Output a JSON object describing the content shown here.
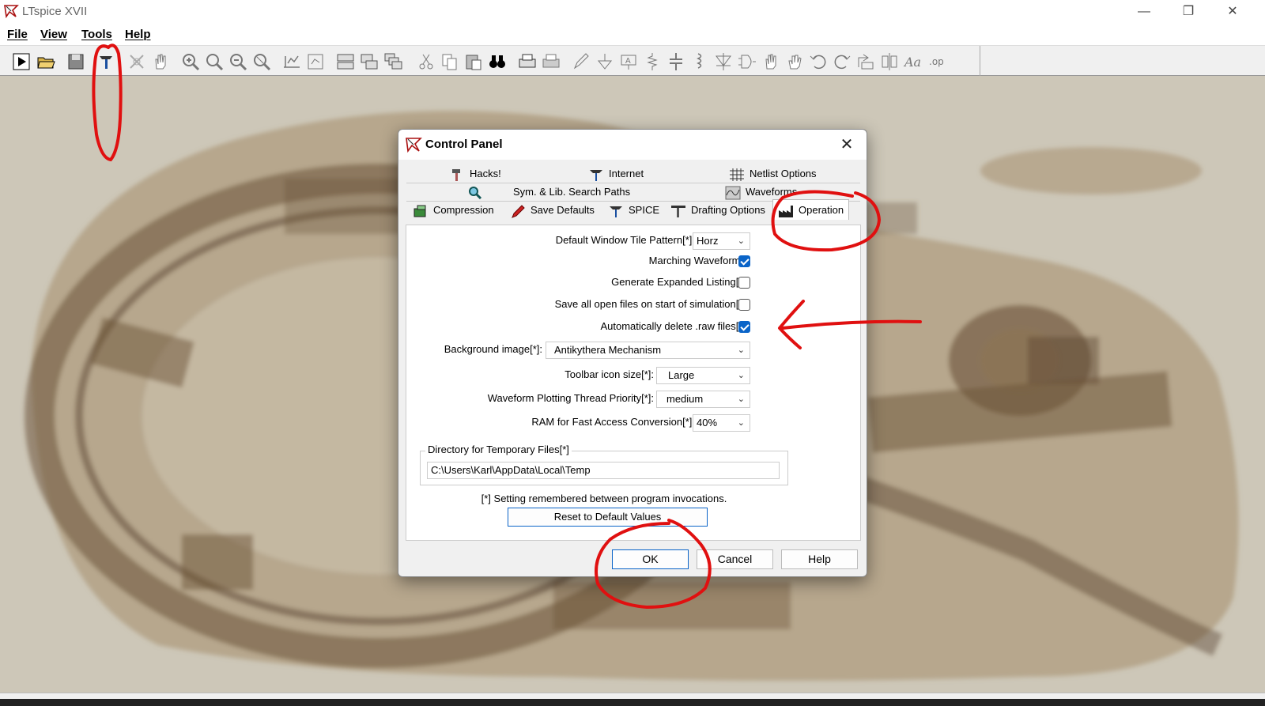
{
  "window": {
    "title": "LTspice XVII",
    "minimize": "—",
    "restore": "❐",
    "close": "✕"
  },
  "menu": {
    "items": [
      {
        "label": "File"
      },
      {
        "label": "View"
      },
      {
        "label": "Tools"
      },
      {
        "label": "Help"
      }
    ]
  },
  "toolbar": {
    "buttons": [
      "run",
      "open",
      "save",
      "control-panel",
      "halt",
      "pan",
      "zoom-in",
      "zoom",
      "zoom-out",
      "zoom-fit",
      "autorange",
      "fit",
      "tile-h",
      "tile-v",
      "cascade",
      "cut",
      "copy",
      "paste",
      "find",
      "print",
      "print-preview",
      "wire",
      "ground",
      "label",
      "resistor",
      "capacitor",
      "inductor",
      "diode",
      "component",
      "move",
      "drag",
      "undo",
      "redo",
      "rotate",
      "mirror",
      "text",
      "spice-directive"
    ]
  },
  "dialog": {
    "title": "Control Panel",
    "close": "✕",
    "tabs": {
      "hacks": "Hacks!",
      "internet": "Internet",
      "netlist": "Netlist Options",
      "sym_lib": "Sym. & Lib. Search Paths",
      "waveforms": "Waveforms",
      "compression": "Compression",
      "save_defaults": "Save Defaults",
      "spice": "SPICE",
      "drafting": "Drafting Options",
      "operation": "Operation"
    },
    "operation": {
      "tile_pattern_label": "Default Window Tile Pattern[*]:",
      "tile_pattern_value": "Horz",
      "marching_label": "Marching Waveforms",
      "marching_checked": true,
      "expanded_label": "Generate Expanded Listing[*]",
      "expanded_checked": false,
      "save_all_label": "Save all open files on start of simulation[*]",
      "save_all_checked": false,
      "auto_delete_label": "Automatically delete .raw files[*]",
      "auto_delete_checked": true,
      "bg_image_label": "Background image[*]:",
      "bg_image_value": "Antikythera Mechanism",
      "icon_size_label": "Toolbar icon size[*]:",
      "icon_size_value": "Large",
      "thread_priority_label": "Waveform Plotting Thread Priority[*]:",
      "thread_priority_value": "medium",
      "ram_label": "RAM for Fast Access Conversion[*]:",
      "ram_value": "40%",
      "temp_dir_label": "Directory for Temporary Files[*]",
      "temp_dir_value": "C:\\Users\\Karl\\AppData\\Local\\Temp",
      "note": "[*] Setting remembered between program invocations.",
      "reset_label": "Reset to Default Values"
    },
    "ok_label": "OK",
    "cancel_label": "Cancel",
    "help_label": "Help"
  },
  "colors": {
    "accent": "#0a64c8",
    "annotation": "#e01010",
    "workspace": "#cdc7b8"
  }
}
